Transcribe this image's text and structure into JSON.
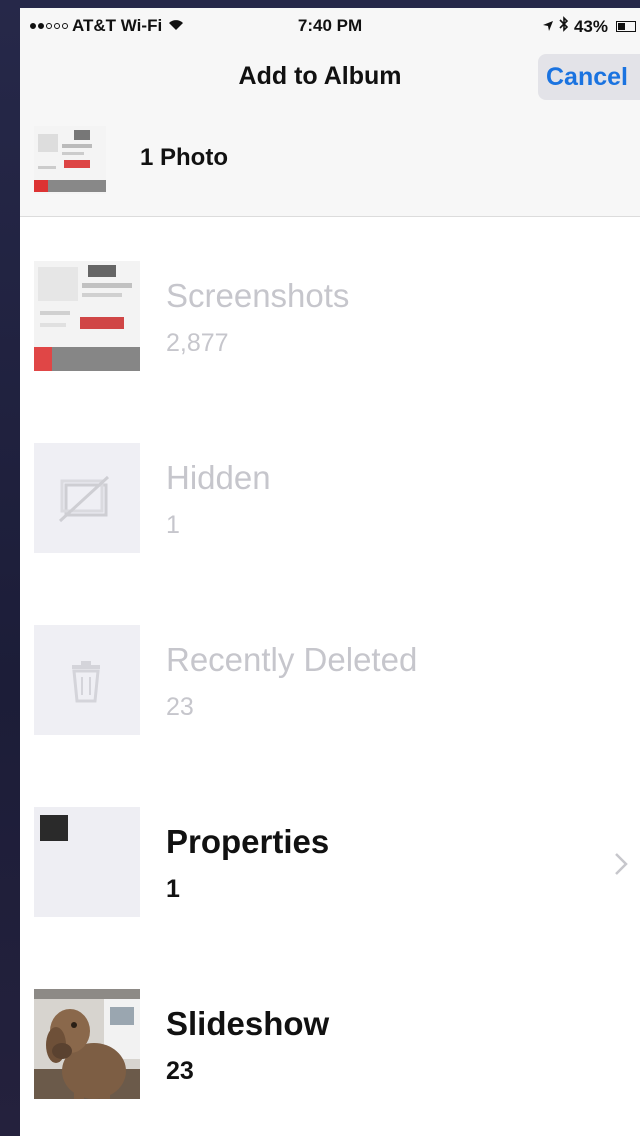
{
  "status_bar": {
    "carrier": "AT&T Wi-Fi",
    "time": "7:40 PM",
    "battery": "43%",
    "battery_level": 0.43,
    "signal_bars_filled": 2,
    "signal_bars_total": 5
  },
  "nav": {
    "title": "Add to Album",
    "cancel_label": "Cancel"
  },
  "selection": {
    "label": "1 Photo"
  },
  "albums": [
    {
      "name": "Screenshots",
      "count": "2,877",
      "enabled": false,
      "icon": "screenshot-thumbnail"
    },
    {
      "name": "Hidden",
      "count": "1",
      "enabled": false,
      "icon": "hidden-icon"
    },
    {
      "name": "Recently Deleted",
      "count": "23",
      "enabled": false,
      "icon": "trash-icon"
    },
    {
      "name": "Properties",
      "count": "1",
      "enabled": true,
      "icon": "properties-thumbnail"
    },
    {
      "name": "Slideshow",
      "count": "23",
      "enabled": true,
      "icon": "dog-photo-thumbnail"
    }
  ],
  "colors": {
    "accent": "#1a73e0",
    "disabled_text": "#c6c6cc",
    "bar_background": "#f7f7f7"
  }
}
